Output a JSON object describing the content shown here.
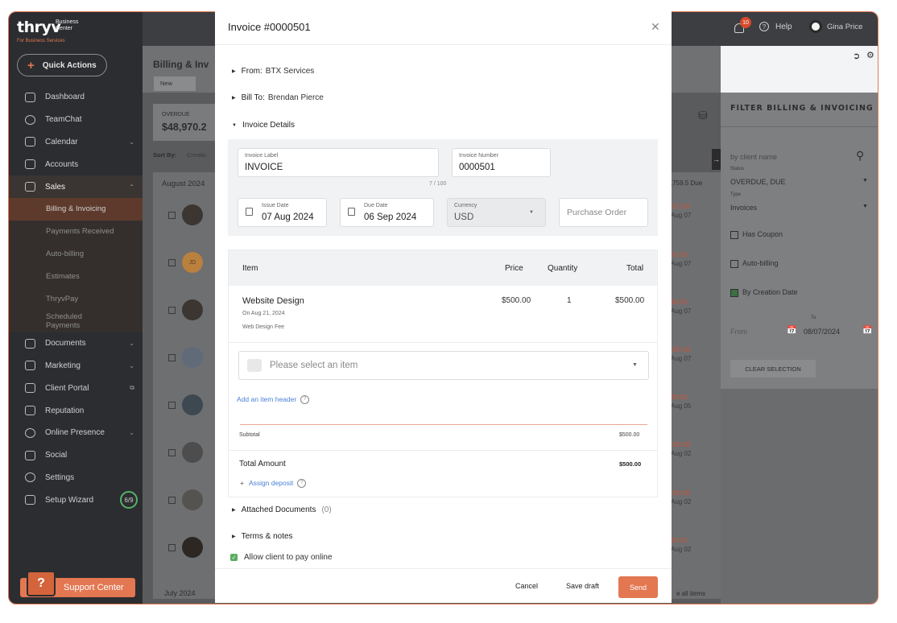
{
  "app": {
    "brand": "thryv",
    "brand_sub": "Business Center",
    "brand_tag": "For Business Services",
    "quick_actions": "Quick Actions",
    "support_center": "Support Center"
  },
  "sidebar": {
    "items": [
      {
        "label": "Dashboard"
      },
      {
        "label": "TeamChat"
      },
      {
        "label": "Calendar"
      },
      {
        "label": "Accounts"
      },
      {
        "label": "Sales"
      }
    ],
    "sub_items": [
      {
        "label": "Billing & Invoicing"
      },
      {
        "label": "Payments Received"
      },
      {
        "label": "Auto-billing"
      },
      {
        "label": "Estimates"
      },
      {
        "label": "ThryvPay"
      },
      {
        "label": "Scheduled Payments"
      }
    ],
    "items_after": [
      {
        "label": "Documents"
      },
      {
        "label": "Marketing"
      },
      {
        "label": "Client Portal"
      },
      {
        "label": "Reputation"
      },
      {
        "label": "Online Presence"
      },
      {
        "label": "Social"
      },
      {
        "label": "Settings"
      },
      {
        "label": "Setup Wizard"
      }
    ],
    "wizard_progress": "6/9"
  },
  "topbar": {
    "notifications": "10",
    "help": "Help",
    "user": "Gina Price"
  },
  "background": {
    "page_title": "Billing & Inv",
    "new_button": "New",
    "overdue_label": "OVERDUE",
    "overdue_amount": "$48,970.2",
    "sort_by": "Sort By:",
    "sort_value": "Creatio",
    "month1": "August 2024",
    "month2": "July 2024",
    "due_total": ",759.5 Due",
    "row_initials": "JD",
    "see_all": "e all items",
    "row_values": [
      {
        "amount": "212.50",
        "date": "Aug 07"
      },
      {
        "amount": "50.00",
        "date": "Aug 07"
      },
      {
        "amount": "99.00",
        "date": "Aug 07"
      },
      {
        "amount": "100.00",
        "date": "Aug 07"
      },
      {
        "amount": "99.00",
        "date": "Aug 05"
      },
      {
        "amount": "100.00",
        "date": "Aug 02"
      },
      {
        "amount": "100.00",
        "date": "Aug 02"
      },
      {
        "amount": "99.00",
        "date": "Aug 02"
      }
    ]
  },
  "filter": {
    "title": "FILTER BILLING & INVOICING",
    "search_placeholder": "by client name",
    "status_label": "Status",
    "status_value": "OVERDUE, DUE",
    "type_label": "Type",
    "type_value": "Invoices",
    "has_coupon": "Has Coupon",
    "auto_billing": "Auto-billing",
    "by_creation_date": "By Creation Date",
    "to_label": "To",
    "from_label": "From",
    "from_date": "08/07/2024",
    "clear": "CLEAR SELECTION"
  },
  "modal": {
    "title": "Invoice #0000501",
    "from_label": "From:",
    "from_value": "BTX Services",
    "billto_label": "Bill To:",
    "billto_value": "Brendan Pierce",
    "details_label": "Invoice Details",
    "invoice_label_label": "Invoice Label",
    "invoice_label_value": "INVOICE",
    "invoice_label_counter": "7 / 100",
    "invoice_number_label": "Invoice Number",
    "invoice_number_value": "0000501",
    "issue_date_label": "Issue Date",
    "issue_date_value": "07 Aug 2024",
    "due_date_label": "Due Date",
    "due_date_value": "06 Sep 2024",
    "currency_label": "Currency",
    "currency_value": "USD",
    "purchase_order_placeholder": "Purchase Order",
    "table": {
      "col_item": "Item",
      "col_price": "Price",
      "col_quantity": "Quantity",
      "col_total": "Total",
      "rows": [
        {
          "name": "Website Design",
          "date": "On Aug 21, 2024",
          "desc": "Web Design Fee",
          "price": "$500.00",
          "qty": "1",
          "total": "$500.00"
        }
      ],
      "select_placeholder": "Please select an item",
      "add_header": "Add an item header",
      "subtotal_label": "Subtotal",
      "subtotal_value": "$500.00",
      "total_label": "Total Amount",
      "total_value": "$500.00",
      "assign_deposit": "Assign deposit"
    },
    "attached_label": "Attached Documents",
    "attached_count": "(0)",
    "terms_label": "Terms & notes",
    "allow_online": "Allow client to pay online",
    "cancel": "Cancel",
    "save_draft": "Save draft",
    "send": "Send"
  }
}
